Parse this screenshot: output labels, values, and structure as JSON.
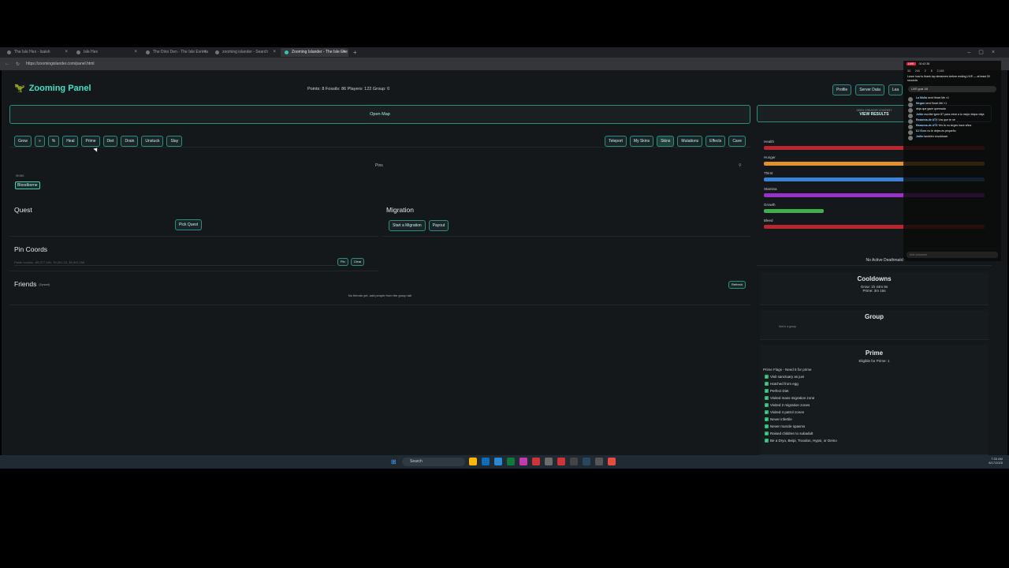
{
  "browser": {
    "tabs": [
      {
        "label": "The Isle Hex - Isaish",
        "active": false
      },
      {
        "label": "Isle Hex",
        "active": false
      },
      {
        "label": "The Dino Den - The Isle Evrima",
        "active": false
      },
      {
        "label": "zooming islander - Search",
        "active": false
      },
      {
        "label": "Zooming Islander - The Isle Eve",
        "active": true
      }
    ],
    "new_tab": "+",
    "url": "https://zoomingislander.com/panel.html"
  },
  "header": {
    "logo_text": "Zooming Panel",
    "stats": "Points: 8  Fossils: 86  Players: 122  Group: 0",
    "buttons": [
      "Profile",
      "Server Data",
      "Lea"
    ]
  },
  "open_map": "Open Map",
  "results": {
    "sub": "SEEN CREATOR CONTEST",
    "main": "VIEW RESULTS"
  },
  "toolbar": {
    "left": [
      "Grow",
      "»",
      "%",
      "Heal",
      "Prime",
      "Diet",
      "Drain",
      "Unstuck",
      "Slay"
    ],
    "right": [
      "Teleport",
      "My Skins",
      "Skins",
      "Mutations",
      "Effects",
      "Cave"
    ],
    "active_right": "Skins"
  },
  "pins": {
    "label": "Pins",
    "flag": "⚲"
  },
  "skins": {
    "label": "SKINS",
    "chip": "Bloodborne"
  },
  "quest": {
    "title": "Quest",
    "button": "Pick Quest"
  },
  "migration": {
    "title": "Migration",
    "buttons": [
      "Start a Migration",
      "Payout"
    ]
  },
  "pin_coords": {
    "title": "Pin Coords",
    "placeholder": "Paste coords: -85,577,184, 76,401.23, 38,941.256",
    "buttons": [
      "Pin",
      "Clear"
    ]
  },
  "friends": {
    "title": "Friends",
    "subtitle": "(Synced)",
    "refresh": "Refresh",
    "empty": "No friends yet, add people from the group tab"
  },
  "stats": [
    {
      "label": "Health",
      "color": "#b8262e",
      "level": 1.0
    },
    {
      "label": "Hunger",
      "color": "#e0922b",
      "level": 1.0
    },
    {
      "label": "Thirst",
      "color": "#3b82d6",
      "level": 1.0
    },
    {
      "label": "Stamina",
      "color": "#9b30c9",
      "level": 1.0
    },
    {
      "label": "Growth",
      "color": "#3fae4d",
      "level": 0.27
    },
    {
      "label": "Bleed",
      "color": "#b8262e",
      "level": 1.0
    }
  ],
  "deathmatch": "No Active Deathmatch",
  "cooldowns": {
    "title": "Cooldowns",
    "lines": [
      "Grow: 1h 44m 8s",
      "Prime: 3m 16s"
    ]
  },
  "group": {
    "title": "Group",
    "empty": "Not in a group"
  },
  "prime": {
    "title": "Prime",
    "eligible": "Eligible for Prime: 1",
    "flags_title": "Prime Flags - Need 5 for prime",
    "flags": [
      "Visit sanctuary as juvi",
      "Hatched from egg",
      "Perfect Diet",
      "Visited mass migration zone",
      "Visited 2 migration zones",
      "Visited 4 patrol zones",
      "Never infertile",
      "Never muscle spasms",
      "Raised children to subadult",
      "Be a Dryo, Beipi, Troodon, Hypsi, or Deino"
    ]
  },
  "chat": {
    "live": "LIVE",
    "time": "00:42:38",
    "stats": [
      "33",
      "244",
      "2",
      "8",
      "2,145"
    ],
    "banner": "Learn how to thank top streamers before ending LIVE — at least 30 seconds",
    "pill": "LIVE goal 1/6",
    "messages": [
      {
        "user": "La Molla",
        "text": "sent Heart Me ×1"
      },
      {
        "user": "Megan",
        "text": "sent Heart Me ×1"
      },
      {
        "user": "",
        "text": "deja que gane quemada"
      },
      {
        "user": "Jolito",
        "text": "escribe igme 87 para crear a tu mejor etapa vieja"
      },
      {
        "user": "Rasanna-de ATX",
        "text": "Vos que te ne"
      },
      {
        "user": "Rasanna-de ATX",
        "text": "Yes tú no sirges hace años"
      },
      {
        "user": "DJ Euro",
        "text": "no le dejes es pequeño"
      },
      {
        "user": "Jolito",
        "text": "también vovoldown"
      }
    ],
    "input_placeholder": "Add comment"
  },
  "taskbar": {
    "search": "Search",
    "time": "7:33 AM",
    "date": "8/17/2025"
  }
}
